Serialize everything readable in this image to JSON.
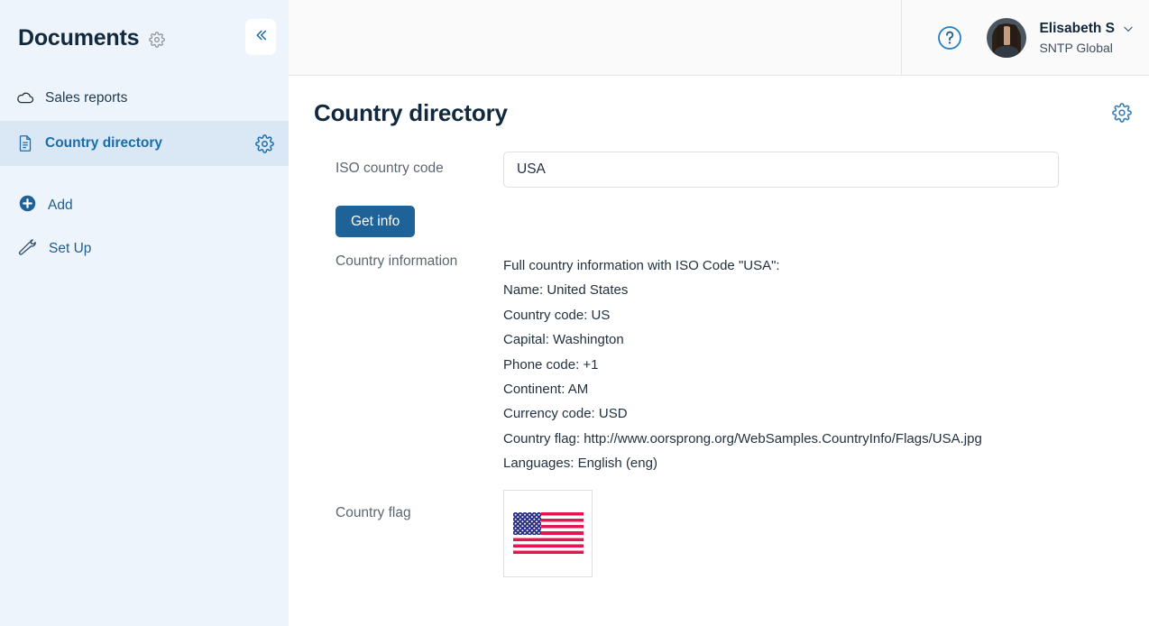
{
  "sidebar": {
    "title": "Documents",
    "title_gear_icon": "gear-icon",
    "collapse_icon": "double-chevron-left-icon",
    "items": [
      {
        "label": "Sales reports",
        "icon": "cloud-icon",
        "active": false,
        "gear": false
      },
      {
        "label": "Country directory",
        "icon": "document-icon",
        "active": true,
        "gear": true
      }
    ],
    "actions": [
      {
        "label": "Add",
        "icon": "plus-circle-icon"
      },
      {
        "label": "Set Up",
        "icon": "wrench-icon"
      }
    ]
  },
  "topbar": {
    "help_icon": "question-mark-circle-icon",
    "avatar": "user-avatar-photo",
    "user_name": "Elisabeth S",
    "user_chevron_icon": "chevron-down-icon",
    "user_org": "SNTP Global"
  },
  "page": {
    "title": "Country directory",
    "settings_icon": "gear-icon"
  },
  "form": {
    "iso_label": "ISO country code",
    "iso_value": "USA",
    "iso_placeholder": "",
    "get_info_label": "Get info",
    "info_label": "Country information",
    "info_lines": [
      "Full country information with ISO Code \"USA\":",
      "Name: United States",
      "Country code: US",
      "Capital: Washington",
      "Phone code: +1",
      "Continent: AM",
      "Currency code: USD",
      "Country flag: http://www.oorsprong.org/WebSamples.CountryInfo/Flags/USA.jpg",
      "Languages: English (eng)"
    ],
    "flag_label": "Country flag",
    "flag_image": "us-flag-image"
  },
  "colors": {
    "sidebar_bg": "#eef4fb",
    "sidebar_active_bg": "#d9e8f4",
    "accent_blue": "#1b6ca8",
    "button_blue": "#1f6298",
    "topbar_bg": "#fafafa",
    "border_grey": "#e3e5e8",
    "label_grey": "#5c6670",
    "flag_red": "#e3174f",
    "flag_blue": "#2b2f85"
  }
}
